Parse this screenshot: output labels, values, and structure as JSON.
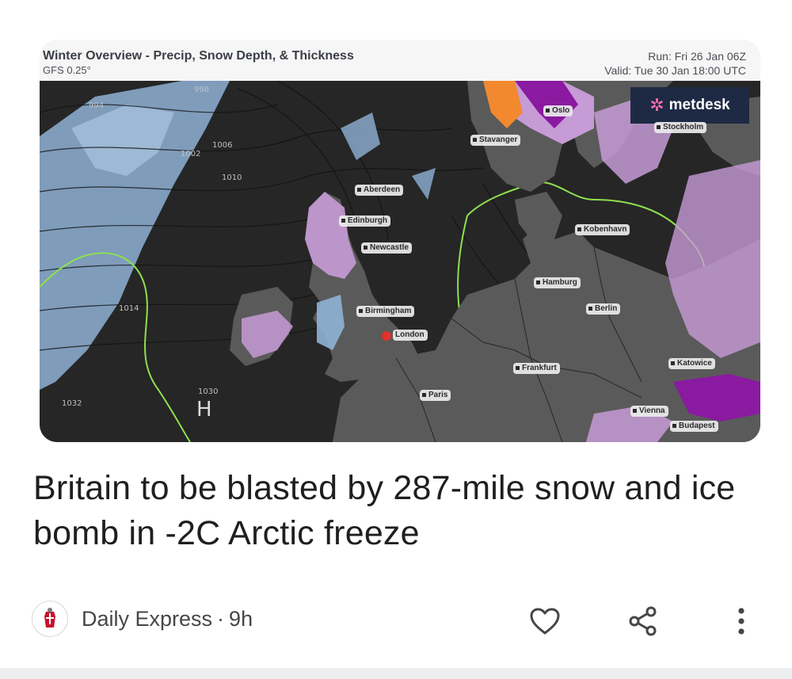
{
  "map": {
    "title": "Winter Overview - Precip, Snow Depth, & Thickness",
    "model": "GFS 0.25°",
    "run": "Run: Fri 26 Jan 06Z",
    "valid": "Valid: Tue 30 Jan 18:00 UTC",
    "brand": "metdesk",
    "pressure_high": "H",
    "isobar_labels": [
      "994",
      "998",
      "1002",
      "1006",
      "1010",
      "1014",
      "1030",
      "1032"
    ],
    "cities": {
      "oslo": "Oslo",
      "stavanger": "Stavanger",
      "stockholm": "Stockholm",
      "aberdeen": "Aberdeen",
      "edinburgh": "Edinburgh",
      "newcastle": "Newcastle",
      "kobenhavn": "Kobenhavn",
      "hamburg": "Hamburg",
      "berlin": "Berlin",
      "birmingham": "Birmingham",
      "london": "London",
      "frankfurt": "Frankfurt",
      "katowice": "Katowice",
      "paris": "Paris",
      "vienna": "Vienna",
      "budapest": "Budapest"
    }
  },
  "article": {
    "headline": "Britain to be blasted by 287-mile snow and ice bomb in -2C Arctic freeze",
    "source": "Daily Express",
    "separator": "·",
    "age": "9h"
  },
  "actions": {
    "like_icon": "heart-icon",
    "share_icon": "share-icon",
    "more_icon": "more-vert-icon"
  },
  "colors": {
    "land": "#5a5a5a",
    "sea": "#262626",
    "snow": "#c79bd6",
    "rain": "#8fb2d6",
    "heavy_snow": "#8a1aa0",
    "thickness_line": "#8fe04e",
    "london_marker": "#e0322e"
  }
}
